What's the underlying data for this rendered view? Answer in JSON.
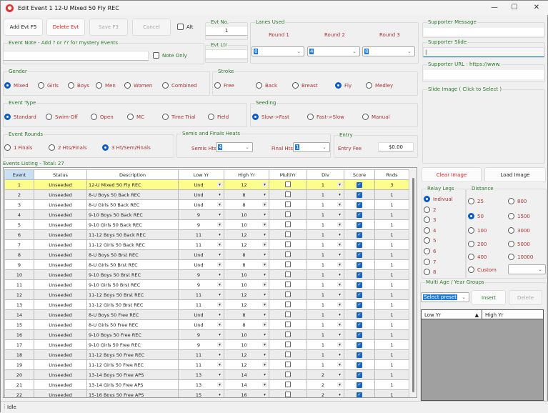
{
  "window": {
    "title": "Edit Event 1 12-U Mixed 50 Fly REC",
    "minimize": "—",
    "maximize": "☐",
    "close": "✕"
  },
  "toolbar": {
    "add": "Add Evt F5",
    "delete": "Delete Evt",
    "save": "Save F3",
    "cancel": "Cancel",
    "alt": "Alt"
  },
  "evt_no": {
    "label": "Evt No.",
    "value": "1"
  },
  "evt_ltr": {
    "label": "Evt Ltr",
    "value": ""
  },
  "note": {
    "label": "Event Note - Add ? or ?? for mystery Events",
    "value": "",
    "note_only": "Note Only"
  },
  "lanes": {
    "label": "Lanes Used",
    "rounds": [
      {
        "label": "Round 1",
        "value": "8"
      },
      {
        "label": "Round 2",
        "value": "4"
      },
      {
        "label": "Round 3",
        "value": "8"
      }
    ]
  },
  "gender": {
    "label": "Gender",
    "options": [
      "Mixed",
      "Girls",
      "Boys",
      "Men",
      "Women",
      "Combined"
    ],
    "selected": "Mixed"
  },
  "stroke": {
    "label": "Stroke",
    "options": [
      "Free",
      "Back",
      "Breast",
      "Fly",
      "Medley"
    ],
    "selected": "Fly"
  },
  "event_type": {
    "label": "Event Type",
    "options": [
      "Standard",
      "Swim-Off",
      "Open",
      "MC",
      "Time Trial",
      "Field"
    ],
    "selected": "Standard"
  },
  "seeding": {
    "label": "Seeding",
    "options": [
      "Slow->Fast",
      "Fast->Slow",
      "Manual"
    ],
    "selected": "Slow->Fast"
  },
  "rounds": {
    "label": "Event Rounds",
    "options": [
      "1 Finals",
      "2 Hts/Finals",
      "3 Ht/Sem/Finals"
    ],
    "selected": "3 Ht/Sem/Finals"
  },
  "heats": {
    "label": "Semis and Finals Heats",
    "semis_label": "Semis Hts",
    "semis": "4",
    "finals_label": "Final Hts",
    "finals": "1"
  },
  "entry": {
    "label": "Entry",
    "fee_label": "Entry Fee",
    "fee": "$0.00"
  },
  "supporter": {
    "message_label": "Supporter Message",
    "message": "",
    "slide_label": "Supporter Slide",
    "slide": "",
    "url_label": "Supporter URL -  https://www.",
    "url": "",
    "image_label": "Slide Image  ( Click to Select )"
  },
  "image_buttons": {
    "clear": "Clear Image",
    "load": "Load Image"
  },
  "relay": {
    "label": "Relay Legs",
    "options": [
      "Indivual",
      "2",
      "3",
      "4",
      "5",
      "6",
      "7",
      "8"
    ],
    "selected": "Indivual"
  },
  "distance": {
    "label": "Distance",
    "options": [
      "25",
      "800",
      "50",
      "1500",
      "100",
      "3000",
      "200",
      "5000",
      "400",
      "10000"
    ],
    "selected": "50",
    "custom": "Custom",
    "custom_value": ""
  },
  "multi_age": {
    "label": "Multi Age / Year Groups",
    "preset": "Select preset",
    "insert": "Insert",
    "delete": "Delete",
    "columns": [
      "Low Yr",
      "High Yr"
    ]
  },
  "events": {
    "label": "Events Listing - Total: 27",
    "columns": [
      "Event",
      "Status",
      "Description",
      "Low Yr",
      "High Yr",
      "MultiYr",
      "Div",
      "Score",
      "Rnds"
    ],
    "rows": [
      [
        "1",
        "Unseeded",
        "12-U Mixed 50 Fly REC",
        "Und",
        "12",
        "1",
        "3"
      ],
      [
        "2",
        "Unseeded",
        "8-U Boys 50 Back REC",
        "Und",
        "8",
        "1",
        "1"
      ],
      [
        "3",
        "Unseeded",
        "8-U Girls 50 Back REC",
        "Und",
        "8",
        "1",
        "1"
      ],
      [
        "4",
        "Unseeded",
        "9-10 Boys 50 Back REC",
        "9",
        "10",
        "1",
        "1"
      ],
      [
        "5",
        "Unseeded",
        "9-10 Girls 50 Back REC",
        "9",
        "10",
        "1",
        "1"
      ],
      [
        "6",
        "Unseeded",
        "11-12 Boys 50 Back REC",
        "11",
        "12",
        "1",
        "1"
      ],
      [
        "7",
        "Unseeded",
        "11-12 Girls 50 Back REC",
        "11",
        "12",
        "1",
        "1"
      ],
      [
        "8",
        "Unseeded",
        "8-U Boys 50 Brst REC",
        "Und",
        "8",
        "1",
        "1"
      ],
      [
        "9",
        "Unseeded",
        "8-U Girls 50 Brst REC",
        "Und",
        "8",
        "1",
        "1"
      ],
      [
        "10",
        "Unseeded",
        "9-10 Boys 50 Brst REC",
        "9",
        "10",
        "1",
        "1"
      ],
      [
        "11",
        "Unseeded",
        "9-10 Girls 50 Brst REC",
        "9",
        "10",
        "1",
        "1"
      ],
      [
        "12",
        "Unseeded",
        "11-12 Boys 50 Brst REC",
        "11",
        "12",
        "1",
        "1"
      ],
      [
        "13",
        "Unseeded",
        "11-12 Girls 50 Brst REC",
        "11",
        "12",
        "1",
        "1"
      ],
      [
        "14",
        "Unseeded",
        "8-U Boys 50 Free REC",
        "Und",
        "8",
        "1",
        "1"
      ],
      [
        "15",
        "Unseeded",
        "8-U Girls 50 Free REC",
        "Und",
        "8",
        "1",
        "1"
      ],
      [
        "16",
        "Unseeded",
        "9-10 Boys 50 Free REC",
        "9",
        "10",
        "1",
        "1"
      ],
      [
        "17",
        "Unseeded",
        "9-10 Girls 50 Free REC",
        "9",
        "10",
        "1",
        "1"
      ],
      [
        "18",
        "Unseeded",
        "11-12 Boys 50 Free REC",
        "11",
        "12",
        "1",
        "1"
      ],
      [
        "19",
        "Unseeded",
        "11-12 Girls 50 Free REC",
        "11",
        "12",
        "1",
        "1"
      ],
      [
        "20",
        "Unseeded",
        "13-14 Boys 50 Free APS",
        "13",
        "14",
        "2",
        "1"
      ],
      [
        "21",
        "Unseeded",
        "13-14 Girls 50 Free APS",
        "13",
        "14",
        "2",
        "1"
      ],
      [
        "22",
        "Unseeded",
        "15-16 Boys 50 Free APS",
        "15",
        "16",
        "2",
        "1"
      ]
    ]
  },
  "status": "Idle"
}
